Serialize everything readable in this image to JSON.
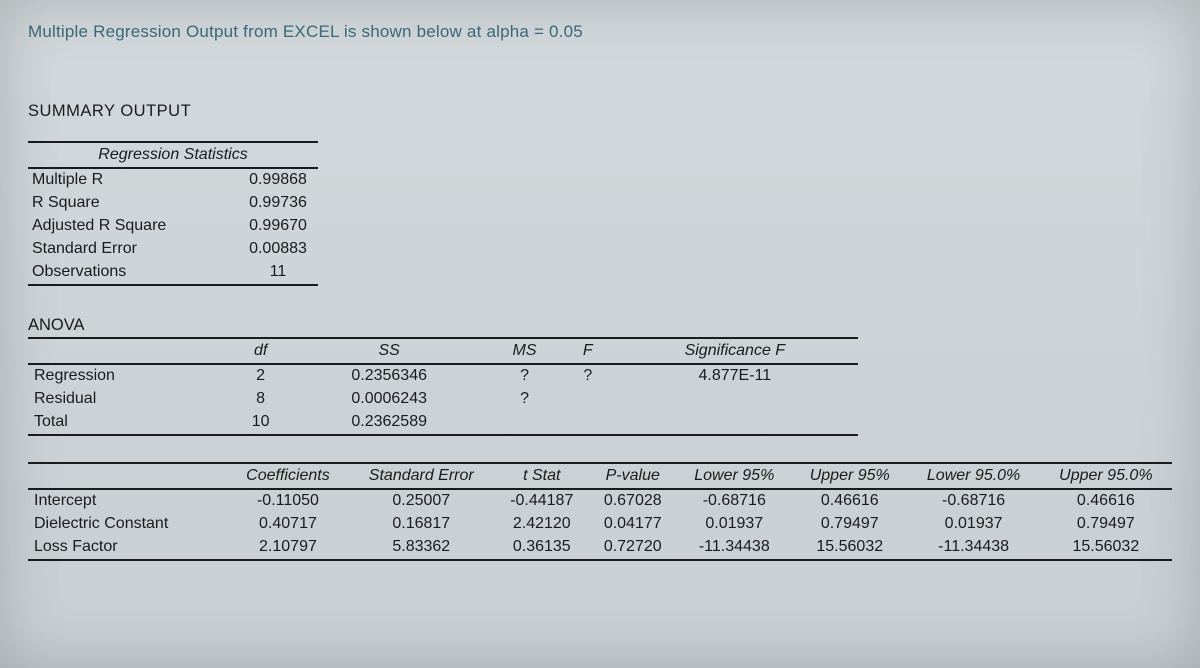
{
  "title": "Multiple Regression Output from EXCEL is shown below at alpha = 0.05",
  "summary_heading": "SUMMARY OUTPUT",
  "regstats": {
    "header": "Regression Statistics",
    "rows": [
      {
        "label": "Multiple R",
        "value": "0.99868"
      },
      {
        "label": "R Square",
        "value": "0.99736"
      },
      {
        "label": "Adjusted R Square",
        "value": "0.99670"
      },
      {
        "label": "Standard Error",
        "value": "0.00883"
      },
      {
        "label": "Observations",
        "value": "11"
      }
    ]
  },
  "anova": {
    "heading": "ANOVA",
    "headers": [
      "",
      "df",
      "SS",
      "MS",
      "F",
      "Significance F"
    ],
    "rows": [
      {
        "c": [
          "Regression",
          "2",
          "0.2356346",
          "?",
          "?",
          "4.877E-11"
        ]
      },
      {
        "c": [
          "Residual",
          "8",
          "0.0006243",
          "?",
          "",
          ""
        ]
      },
      {
        "c": [
          "Total",
          "10",
          "0.2362589",
          "",
          "",
          ""
        ]
      }
    ]
  },
  "coeff": {
    "headers": [
      "",
      "Coefficients",
      "Standard Error",
      "t Stat",
      "P-value",
      "Lower 95%",
      "Upper 95%",
      "Lower 95.0%",
      "Upper 95.0%"
    ],
    "rows": [
      {
        "c": [
          "Intercept",
          "-0.11050",
          "0.25007",
          "-0.44187",
          "0.67028",
          "-0.68716",
          "0.46616",
          "-0.68716",
          "0.46616"
        ]
      },
      {
        "c": [
          "Dielectric Constant",
          "0.40717",
          "0.16817",
          "2.42120",
          "0.04177",
          "0.01937",
          "0.79497",
          "0.01937",
          "0.79497"
        ]
      },
      {
        "c": [
          "Loss Factor",
          "2.10797",
          "5.83362",
          "0.36135",
          "0.72720",
          "-11.34438",
          "15.56032",
          "-11.34438",
          "15.56032"
        ]
      }
    ]
  },
  "chart_data": {
    "type": "table",
    "title": "Multiple Regression Output (alpha = 0.05)",
    "regression_statistics": {
      "Multiple R": 0.99868,
      "R Square": 0.99736,
      "Adjusted R Square": 0.9967,
      "Standard Error": 0.00883,
      "Observations": 11
    },
    "anova": {
      "columns": [
        "df",
        "SS",
        "MS",
        "F",
        "Significance F"
      ],
      "Regression": {
        "df": 2,
        "SS": 0.2356346,
        "MS": null,
        "F": null,
        "Significance F": 4.877e-11
      },
      "Residual": {
        "df": 8,
        "SS": 0.0006243,
        "MS": null
      },
      "Total": {
        "df": 10,
        "SS": 0.2362589
      }
    },
    "coefficients": {
      "columns": [
        "Coefficients",
        "Standard Error",
        "t Stat",
        "P-value",
        "Lower 95%",
        "Upper 95%",
        "Lower 95.0%",
        "Upper 95.0%"
      ],
      "Intercept": {
        "coef": -0.1105,
        "se": 0.25007,
        "t": -0.44187,
        "p": 0.67028,
        "lo95": -0.68716,
        "hi95": 0.46616,
        "lo95_0": -0.68716,
        "hi95_0": 0.46616
      },
      "Dielectric Constant": {
        "coef": 0.40717,
        "se": 0.16817,
        "t": 2.4212,
        "p": 0.04177,
        "lo95": 0.01937,
        "hi95": 0.79497,
        "lo95_0": 0.01937,
        "hi95_0": 0.79497
      },
      "Loss Factor": {
        "coef": 2.10797,
        "se": 5.83362,
        "t": 0.36135,
        "p": 0.7272,
        "lo95": -11.34438,
        "hi95": 15.56032,
        "lo95_0": -11.34438,
        "hi95_0": 15.56032
      }
    }
  }
}
